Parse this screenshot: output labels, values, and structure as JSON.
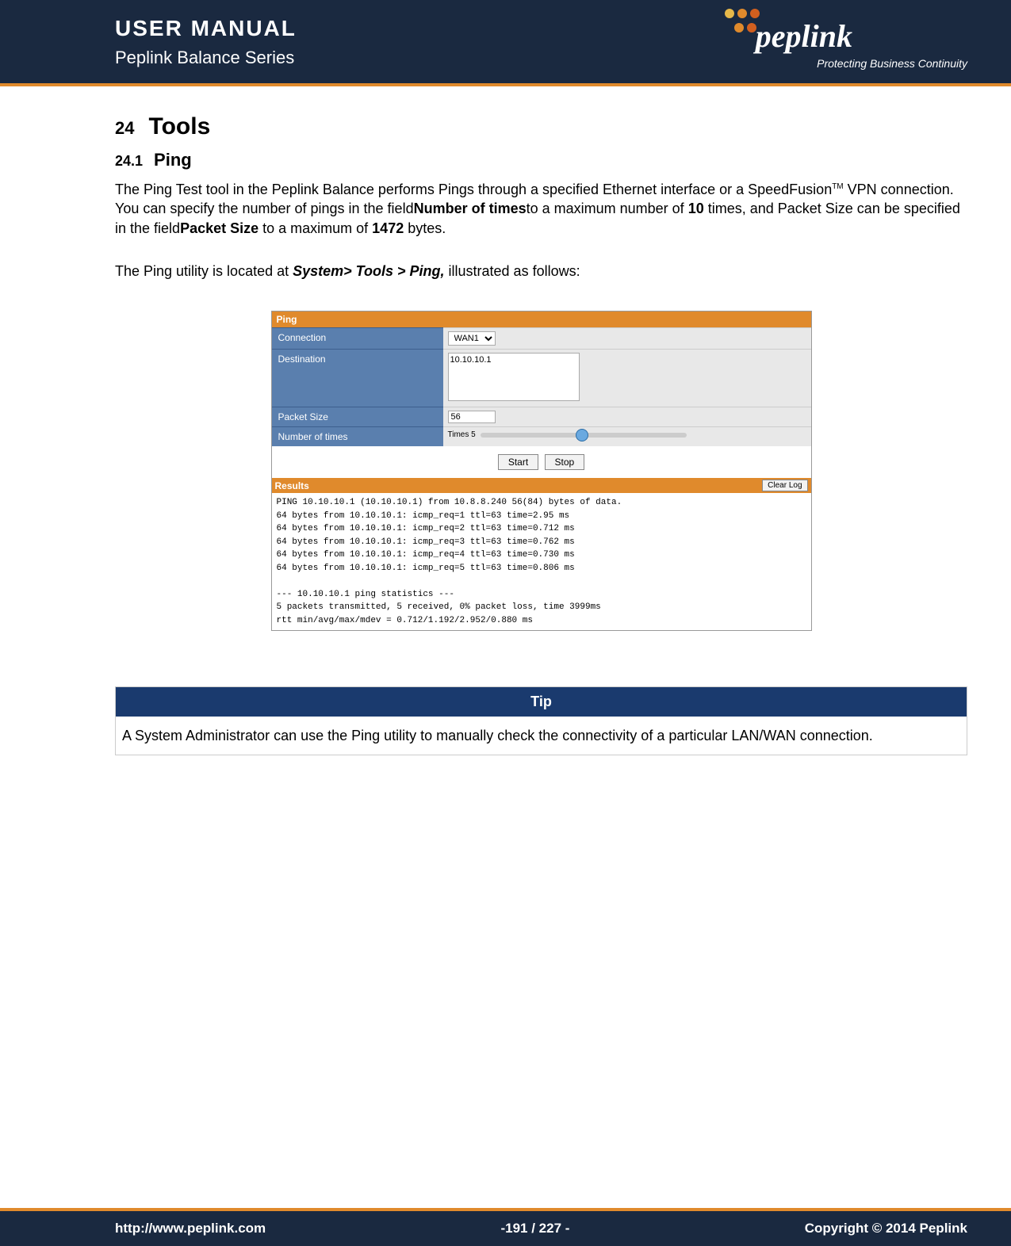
{
  "header": {
    "title": "USER MANUAL",
    "subtitle": "Peplink Balance Series",
    "brand": "peplink",
    "tagline": "Protecting Business Continuity"
  },
  "section": {
    "num": "24",
    "title": "Tools",
    "sub_num": "24.1",
    "sub_title": "Ping"
  },
  "body": {
    "p1_a": "The Ping Test tool in the Peplink Balance performs Pings through a specified Ethernet interface or a SpeedFusion",
    "p1_tm": "TM",
    "p1_b": " VPN connection. You can specify the number of pings in the field",
    "p1_bold1": "Number of times",
    "p1_c": "to a maximum number of ",
    "p1_bold2": "10",
    "p1_d": " times, and Packet Size can be specified in the field",
    "p1_bold3": "Packet Size",
    "p1_e": " to a maximum of ",
    "p1_bold4": "1472",
    "p1_f": " bytes.",
    "p2_a": "The Ping utility is located at ",
    "p2_bold": "System> Tools > Ping,",
    "p2_b": " illustrated as follows:"
  },
  "ping": {
    "head": "Ping",
    "conn_label": "Connection",
    "conn_value": "WAN1",
    "dest_label": "Destination",
    "dest_value": "10.10.10.1",
    "size_label": "Packet Size",
    "size_value": "56",
    "times_label": "Number of times",
    "times_text": "Times   5",
    "start": "Start",
    "stop": "Stop",
    "results_head": "Results",
    "clear": "Clear Log",
    "results": "PING 10.10.10.1 (10.10.10.1) from 10.8.8.240 56(84) bytes of data.\n64 bytes from 10.10.10.1: icmp_req=1 ttl=63 time=2.95 ms\n64 bytes from 10.10.10.1: icmp_req=2 ttl=63 time=0.712 ms\n64 bytes from 10.10.10.1: icmp_req=3 ttl=63 time=0.762 ms\n64 bytes from 10.10.10.1: icmp_req=4 ttl=63 time=0.730 ms\n64 bytes from 10.10.10.1: icmp_req=5 ttl=63 time=0.806 ms\n\n--- 10.10.10.1 ping statistics ---\n5 packets transmitted, 5 received, 0% packet loss, time 3999ms\nrtt min/avg/max/mdev = 0.712/1.192/2.952/0.880 ms"
  },
  "tip": {
    "head": "Tip",
    "body": "A System Administrator can use the Ping utility to manually check the connectivity of a particular LAN/WAN connection."
  },
  "footer": {
    "url": "http://www.peplink.com",
    "page": "-191 / 227 -",
    "copy": "Copyright © 2014 Peplink"
  }
}
